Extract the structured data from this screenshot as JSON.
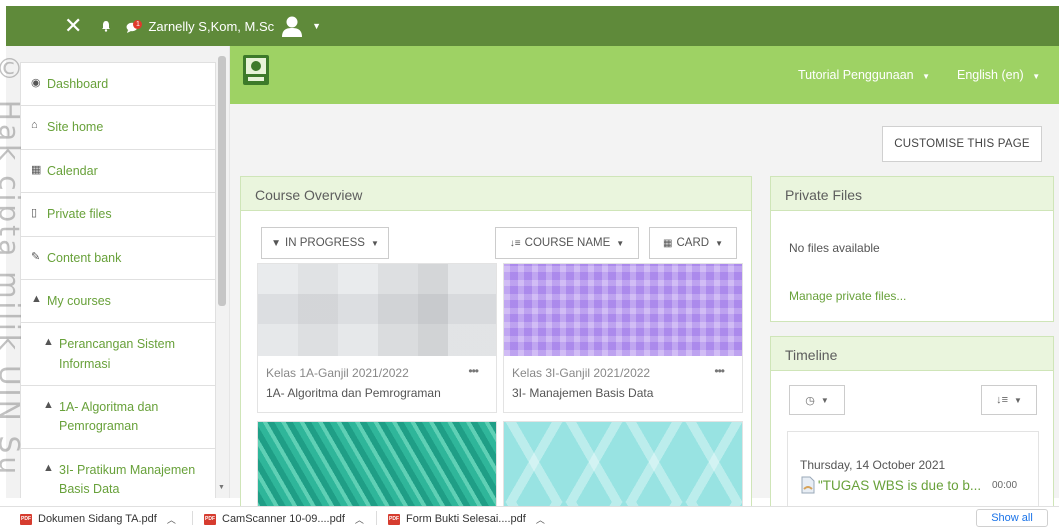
{
  "navbar": {
    "username": "Zarnelly S,Kom, M.Sc",
    "message_badge": "1",
    "colors": {
      "navbar_bg": "#5f8a3a",
      "badge": "#e03a2d"
    }
  },
  "sidebar": {
    "items": [
      {
        "label": "Dashboard",
        "icon": "dashboard-icon"
      },
      {
        "label": "Site home",
        "icon": "home-icon"
      },
      {
        "label": "Calendar",
        "icon": "calendar-icon"
      },
      {
        "label": "Private files",
        "icon": "file-icon"
      },
      {
        "label": "Content bank",
        "icon": "brush-icon"
      },
      {
        "label": "My courses",
        "icon": "graduation-cap-icon"
      },
      {
        "label": "Perancangan Sistem Informasi",
        "icon": "graduation-cap-icon"
      },
      {
        "label": "1A- Algoritma dan Pemrograman",
        "icon": "graduation-cap-icon"
      },
      {
        "label": "3I- Pratikum Manajemen Basis Data",
        "icon": "graduation-cap-icon"
      }
    ]
  },
  "watermark": "© Hak cipta milik UIN Su",
  "header": {
    "tutorial_label": "Tutorial Penggunaan",
    "language_label": "English (en)",
    "colors": {
      "banner_bg": "#9ed264",
      "link": "#68a13a"
    }
  },
  "main": {
    "customise_label": "CUSTOMISE THIS PAGE",
    "course_overview": {
      "title": "Course Overview",
      "filter_label": "IN PROGRESS",
      "sort_label": "COURSE NAME",
      "view_label": "CARD",
      "courses": [
        {
          "category": "Kelas 1A-Ganjil 2021/2022",
          "name": "1A- Algoritma dan Pemrograman",
          "pattern": "gray"
        },
        {
          "category": "Kelas 3I-Ganjil 2021/2022",
          "name": "3I- Manajemen Basis Data",
          "pattern": "purple"
        },
        {
          "category": "",
          "name": "",
          "pattern": "teal"
        },
        {
          "category": "",
          "name": "",
          "pattern": "cyan"
        }
      ]
    },
    "private_files": {
      "title": "Private Files",
      "empty_text": "No files available",
      "manage_link": "Manage private files..."
    },
    "timeline": {
      "title": "Timeline",
      "event_date": "Thursday, 14 October 2021",
      "event_title": "\"TUGAS WBS is due to b...",
      "event_time": "00:00"
    }
  },
  "downloads": {
    "items": [
      {
        "name": "Dokumen Sidang TA.pdf"
      },
      {
        "name": "CamScanner 10-09....pdf"
      },
      {
        "name": "Form Bukti Selesai....pdf"
      }
    ],
    "show_all_label": "Show all"
  }
}
